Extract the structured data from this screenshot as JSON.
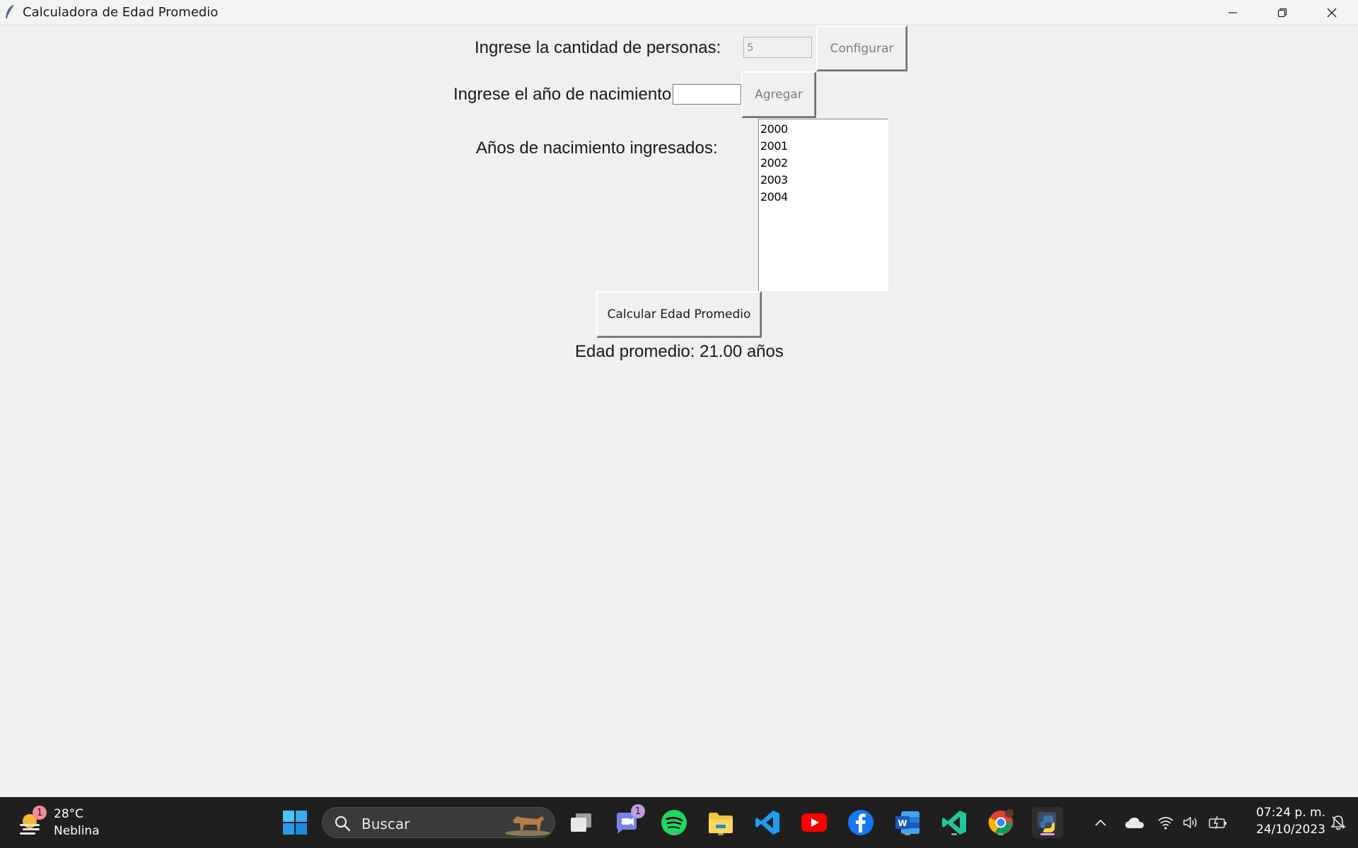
{
  "window": {
    "title": "Calculadora de Edad Promedio"
  },
  "form": {
    "count_label": "Ingrese la cantidad de personas:",
    "count_value": "5",
    "configure_label": "Configurar",
    "year_label": "Ingrese el año de nacimiento:",
    "year_value": "",
    "add_label": "Agregar",
    "entered_label": "Años de nacimiento ingresados:",
    "years": [
      "2000",
      "2001",
      "2002",
      "2003",
      "2004"
    ],
    "calculate_label": "Calcular Edad Promedio",
    "result_text": "Edad promedio: 21.00 años"
  },
  "taskbar": {
    "weather": {
      "temp": "28°C",
      "desc": "Neblina",
      "badge": "1",
      "icon": "weather-haze-icon"
    },
    "search_placeholder": "Buscar",
    "chat_badge": "1",
    "pinned": [
      "start-icon",
      "task-view-icon",
      "teams-chat-icon",
      "spotify-icon",
      "file-explorer-icon",
      "vscode-icon",
      "youtube-icon",
      "facebook-icon",
      "word-icon",
      "visual-studio-icon",
      "chrome-icon",
      "python-icon"
    ],
    "clock": {
      "time": "07:24 p. m.",
      "date": "24/10/2023"
    }
  },
  "colors": {
    "accent": "#0078d4",
    "taskbar_bg": "#1f1f1f",
    "window_bg": "#f0f0f0"
  }
}
